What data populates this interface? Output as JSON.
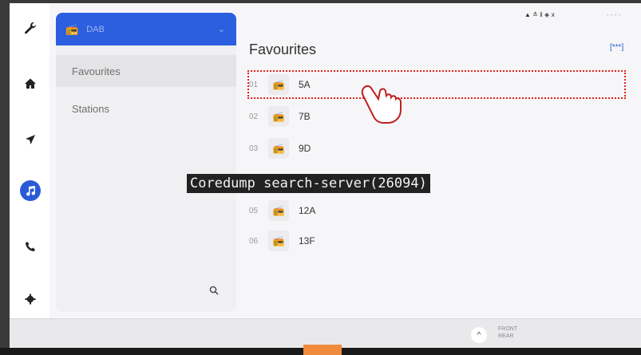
{
  "source_selector": {
    "label": "DAB",
    "chevron": "⌄"
  },
  "menu": {
    "favourites": "Favourites",
    "stations": "Stations"
  },
  "main": {
    "title": "Favourites",
    "more_label": "[***]"
  },
  "header": {
    "status": "▲   ≛ ⅱ ◈ ⅹ",
    "dots": "- - - -"
  },
  "favourites": [
    {
      "number": "01",
      "name": "5A"
    },
    {
      "number": "02",
      "name": "7B"
    },
    {
      "number": "03",
      "name": "9D"
    },
    {
      "number": "05",
      "name": "12A"
    },
    {
      "number": "06",
      "name": "13F"
    }
  ],
  "overlay_text": "Coredump search-server(26094)",
  "bottom": {
    "up_glyph": "^",
    "front": "FRONT",
    "rear": "REAR"
  },
  "colors": {
    "accent": "#2c5fe0",
    "highlight_outline": "#e02020"
  }
}
